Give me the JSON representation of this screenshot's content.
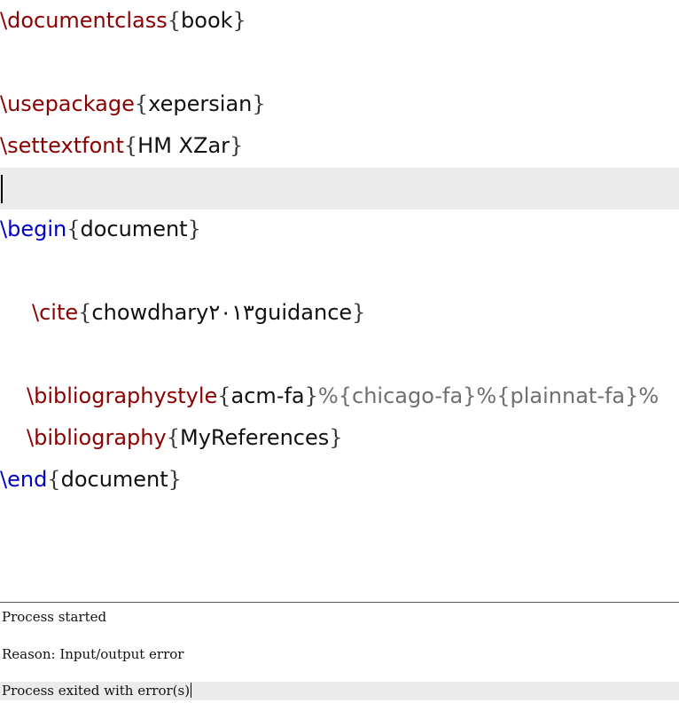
{
  "editor": {
    "lines": [
      {
        "cmd": "\\documentclass",
        "arg": "book"
      },
      {
        "cmd": "\\usepackage",
        "arg": "xepersian"
      },
      {
        "cmd": "\\settextfont",
        "arg": "HM XZar"
      },
      {
        "cmd": "\\begin",
        "arg": "document"
      },
      {
        "cmd": "\\cite",
        "arg": "chowdhary٢٠١٣guidance"
      },
      {
        "cmd": "\\bibliographystyle",
        "arg": "acm-fa",
        "comment": "%{chicago-fa}%{plainnat-fa}%"
      },
      {
        "cmd": "\\bibliography",
        "arg": "MyReferences"
      },
      {
        "cmd": "\\end",
        "arg": "document"
      }
    ],
    "brace_open": "{",
    "brace_close": "}"
  },
  "log": {
    "lines": [
      "Process started",
      "Reason: Input/output error",
      "Process exited with error(s)"
    ]
  },
  "colors": {
    "command": "#8b0000",
    "environment": "#0000c8",
    "comment": "#6f6f6f",
    "current_line": "#ebebeb"
  }
}
